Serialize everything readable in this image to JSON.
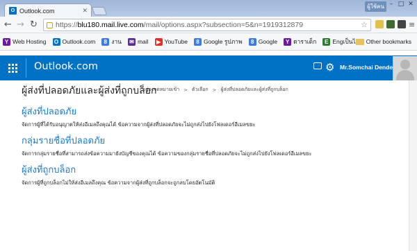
{
  "browser": {
    "tab_title": "Outlook.com",
    "tab_close": "✕",
    "user_label": "ผู้ใช้คน",
    "url_prefix": "https://",
    "url_host": "blu180.mail.live.com",
    "url_path": "/mail/options.aspx?subsection=5&n=1919312879",
    "bookmarks": [
      {
        "label": "Web Hosting",
        "icon": "yahoo-icon",
        "color": "#6a1b9a",
        "glyph": "Y"
      },
      {
        "label": "Outlook.com",
        "icon": "outlook-icon",
        "color": "#0072c6",
        "glyph": "O"
      },
      {
        "label": "งาน",
        "icon": "google-icon",
        "color": "#3b7be8",
        "glyph": "8"
      },
      {
        "label": "mail",
        "icon": "mail-icon",
        "color": "#5c2d91",
        "glyph": "✉"
      },
      {
        "label": "YouTube",
        "icon": "youtube-icon",
        "color": "#e52d27",
        "glyph": "▶"
      },
      {
        "label": "Google รูปภาพ",
        "icon": "google-icon",
        "color": "#3b7be8",
        "glyph": "8"
      },
      {
        "label": "Google",
        "icon": "google-icon",
        "color": "#3b7be8",
        "glyph": "8"
      },
      {
        "label": "ดาราเด็ก",
        "icon": "yahoo-icon",
        "color": "#6a1b9a",
        "glyph": "Y"
      },
      {
        "label": "Engเป็นไทย",
        "icon": "book-icon",
        "color": "#2e7d32",
        "glyph": "E"
      }
    ],
    "other_bookmarks": "Other bookmarks"
  },
  "header": {
    "brand": "Outlook.com",
    "user_name": "Mr.Somchai Dendee",
    "accent": "#0072c6"
  },
  "page": {
    "title": "ผู้ส่งที่ปลอดภัยและผู้ส่งที่ถูกบล็อก",
    "breadcrumb": [
      "กล่องจดหมายเข้า",
      "ตัวเลือก",
      "ผู้ส่งที่ปลอดภัยและผู้ส่งที่ถูกบล็อก"
    ],
    "breadcrumb_sep": ">",
    "sections": [
      {
        "title": "ผู้ส่งที่ปลอดภัย",
        "desc": "จัดการผู้ที่ได้รับอนุญาตให้ส่งอีเมลถึงคุณได้ ข้อความจากผู้ส่งที่ปลอดภัยจะไม่ถูกส่งไปยังโฟลเดอร์อีเมลขยะ"
      },
      {
        "title": "กลุ่มรายชื่อที่ปลอดภัย",
        "desc": "จัดการกลุ่มรายชื่อที่สามารถส่งข้อความมายังบัญชีของคุณได้ ข้อความของกลุ่มรายชื่อที่ปลอดภัยจะไม่ถูกส่งไปยังโฟลเดอร์อีเมลขยะ"
      },
      {
        "title": "ผู้ส่งที่ถูกบล็อก",
        "desc": "จัดการผู้ที่ถูกบล็อกไม่ให้ส่งอีเมลถึงคุณ ข้อความจากผู้ส่งที่ถูกบล็อกจะถูกลบโดยอัตโนมัติ"
      }
    ]
  }
}
